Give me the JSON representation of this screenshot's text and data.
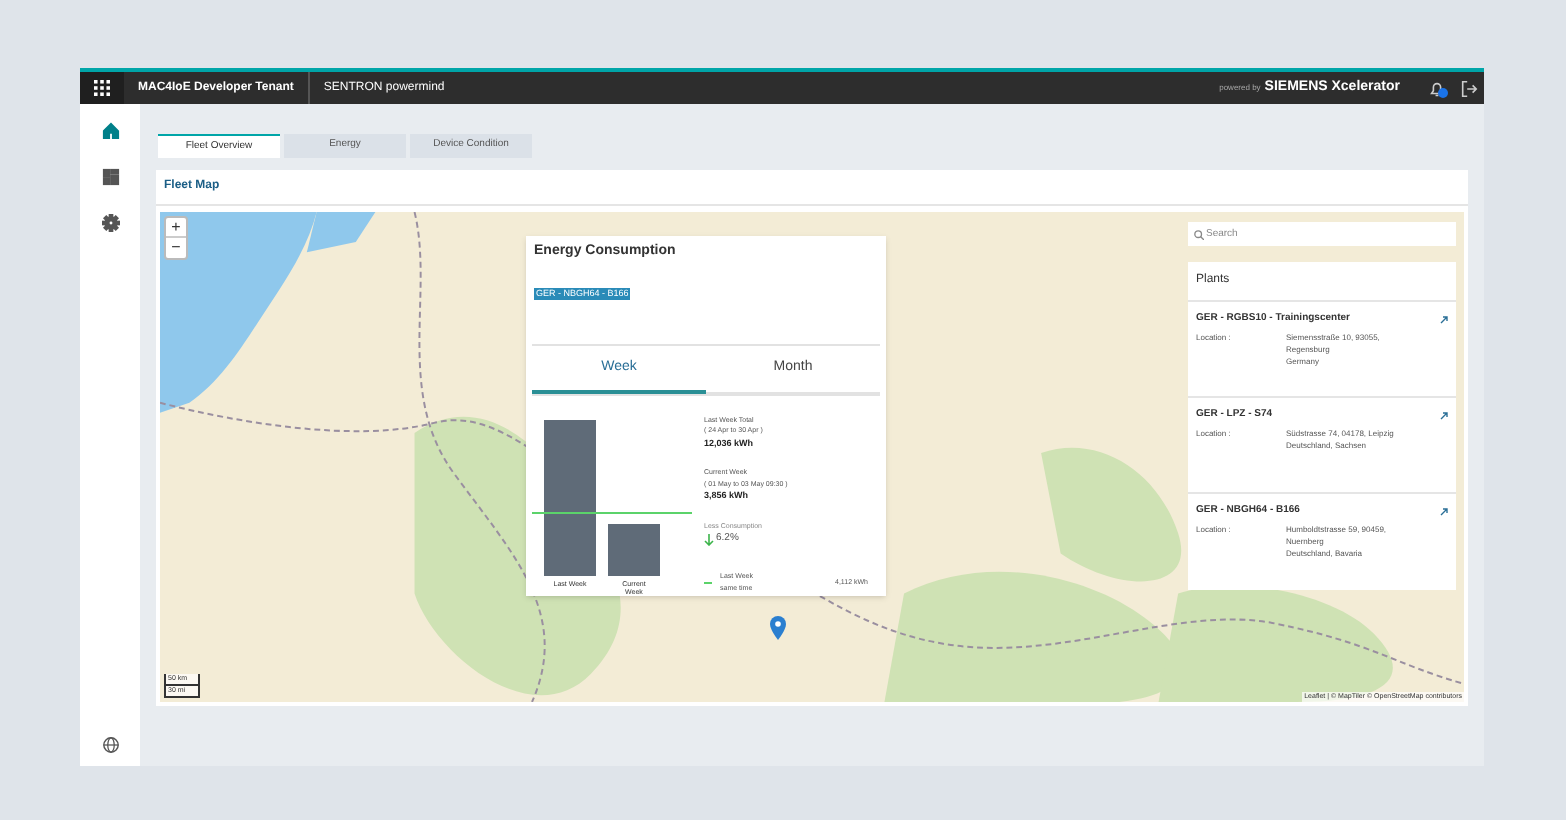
{
  "top_bar": {
    "tenant": "MAC4IoE Developer Tenant",
    "app": "SENTRON powermind",
    "powered_by": "powered by",
    "brand": "SIEMENS Xcelerator",
    "has_notification": true
  },
  "sidebar": {
    "items": [
      {
        "kind": "home",
        "selected": true
      },
      {
        "kind": "dashboard",
        "selected": false
      },
      {
        "kind": "settings",
        "selected": false
      }
    ],
    "bottom": {
      "kind": "globe",
      "selected": false
    }
  },
  "tabs": [
    {
      "label": "Fleet Overview",
      "selected": true
    },
    {
      "label": "Energy",
      "selected": false
    },
    {
      "label": "Device Condition",
      "selected": false
    }
  ],
  "card": {
    "title": "Fleet Map"
  },
  "map": {
    "zoom_in": "+",
    "zoom_out": "−",
    "scale": [
      "50 km",
      "30 mi"
    ],
    "attribution": "Leaflet | © MapTiler © OpenStreetMap contributors"
  },
  "energy_popup": {
    "title": "Energy Consumption",
    "device": "GER - NBGH64 - B166",
    "tabs": [
      {
        "label": "Week",
        "selected": true
      },
      {
        "label": "Month",
        "selected": false
      }
    ],
    "bar_labels": [
      "Last Week",
      "Current Week"
    ],
    "stats": [
      {
        "kind": "total",
        "label": "Last Week Total",
        "period": "( 24 Apr to 30 Apr )",
        "value": "12,036 kWh"
      },
      {
        "kind": "total",
        "label": "Current Week",
        "period": "( 01 May to 03 May 09:30 )",
        "value": "3,856 kWh"
      },
      {
        "kind": "change",
        "label": "Less Consumption",
        "value": "6.2%"
      },
      {
        "kind": "legend",
        "label": "Last Week same time",
        "value": "4,112 kWh"
      }
    ]
  },
  "plants": {
    "search_placeholder": "Search",
    "title": "Plants",
    "items": [
      {
        "name": "GER - RGBS10 - Trainingscenter",
        "location_label": "Location :",
        "address": [
          "Siemensstraße 10, 93055,",
          "Regensburg",
          "Germany"
        ]
      },
      {
        "name": "GER - LPZ - S74",
        "location_label": "Location :",
        "address": [
          "Südstrasse 74, 04178, Leipzig",
          "Deutschland, Sachsen"
        ]
      },
      {
        "name": "GER - NBGH64 - B166",
        "location_label": "Location :",
        "address": [
          "Humboldtstrasse 59, 90459,",
          "Nuernberg",
          "Deutschland, Bavaria"
        ]
      }
    ]
  }
}
